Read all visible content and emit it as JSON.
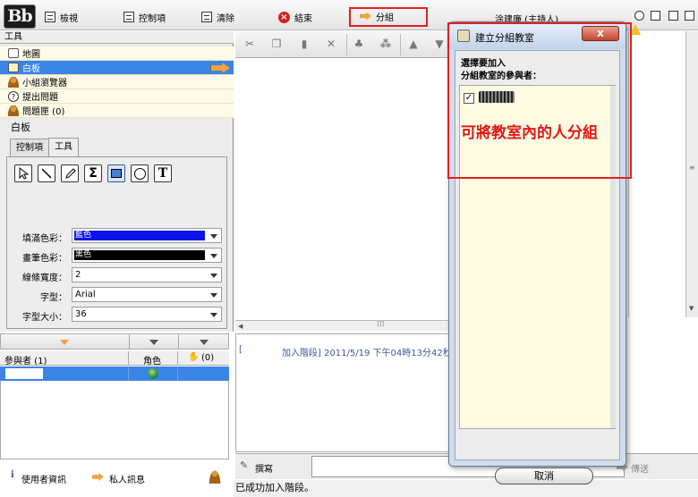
{
  "toolbar": {
    "logo": "Bb",
    "items": [
      {
        "label": "檢視"
      },
      {
        "label": "控制項"
      },
      {
        "label": "清除"
      },
      {
        "label": "結束"
      },
      {
        "label": "分組"
      }
    ],
    "presenter": "涂建廉 (主持人)"
  },
  "tools_panel": {
    "header": "工具",
    "items": [
      {
        "label": "地圖"
      },
      {
        "label": "白板"
      },
      {
        "label": "小組瀏覽器"
      },
      {
        "label": "提出問題"
      },
      {
        "label": "問題匣 (0)"
      }
    ]
  },
  "whiteboard": {
    "title": "白板",
    "tabs": [
      "控制項",
      "工具"
    ],
    "properties": [
      {
        "label": "填滿色彩：",
        "value": "藍色",
        "color": "#0a14e8"
      },
      {
        "label": "畫筆色彩：",
        "value": "黑色",
        "color": "#000000"
      },
      {
        "label": "線條寬度：",
        "value": "2"
      },
      {
        "label": "字型：",
        "value": "Arial"
      },
      {
        "label": "字型大小：",
        "value": "36"
      }
    ]
  },
  "participants": {
    "header": "參與者 (1)",
    "role_col": "角色",
    "hand_col": "(0)"
  },
  "bottom": {
    "user_info": "使用者資訊",
    "private_msg": "私人訊息"
  },
  "chat": {
    "message": "加入階段] 2011/5/19 下午04時13分42秒",
    "input_label": "撰寫",
    "send_label": "傳送",
    "status": "已成功加入階段。"
  },
  "dialog": {
    "title": "建立分組教室",
    "instruction_1": "選擇要加入",
    "instruction_2": "分組教室的參與者：",
    "cancel": "取消",
    "close": "x"
  },
  "annotation": "可將教室內的人分組",
  "colors": {
    "accent": "#3a84e8",
    "highlight": "#e22020"
  }
}
